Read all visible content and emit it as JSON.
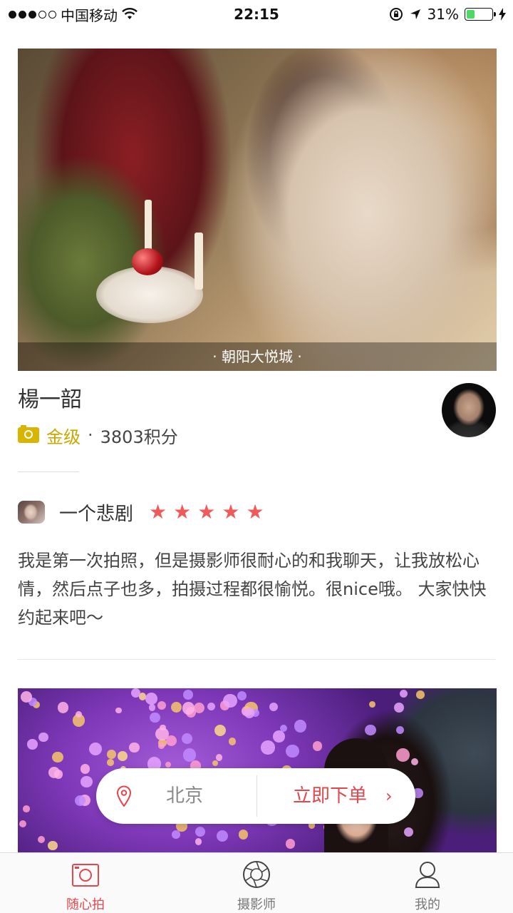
{
  "status_bar": {
    "carrier": "中国移动",
    "time": "22:15",
    "battery": "31%",
    "battery_level": 0.31,
    "signal_bars": 3
  },
  "post1": {
    "location": "· 朝阳大悦城 ·",
    "photographer_name": "楊一韶",
    "level": "金级",
    "separator": "·",
    "points": "3803积分"
  },
  "review": {
    "user_name": "一个悲剧",
    "rating": 5,
    "text": "我是第一次拍照，但是摄影师很耐心的和我聊天，让我放松心情，然后点子也多，拍摄过程都很愉悦。很nice哦。  大家快快约起来吧～"
  },
  "order_bar": {
    "city": "北京",
    "button_label": "立即下单",
    "chevron": "›"
  },
  "tabs": [
    {
      "label": "随心拍",
      "icon": "camera-icon",
      "active": true
    },
    {
      "label": "摄影师",
      "icon": "aperture-icon",
      "active": false
    },
    {
      "label": "我的",
      "icon": "user-icon",
      "active": false
    }
  ],
  "colors": {
    "accent": "#e0484e",
    "gold": "#c8a800",
    "star": "#f05a5a"
  }
}
